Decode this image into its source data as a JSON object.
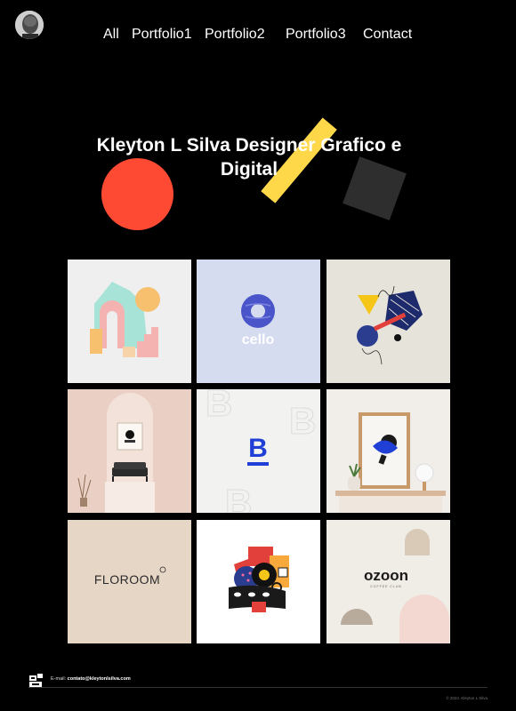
{
  "header": {
    "avatar_icon": "profile-photo",
    "nav": [
      {
        "label": "All"
      },
      {
        "label": "Portfolio1"
      },
      {
        "label": "Portfolio2"
      },
      {
        "label": "Portfolio3"
      },
      {
        "label": "Contact"
      }
    ]
  },
  "hero": {
    "title_line1": "Kleyton L Silva Designer Grafico e",
    "title_line2": "Digital",
    "colors": {
      "circle": "#ff4a33",
      "bar": "#ffd84a",
      "square": "#2e2e2e"
    }
  },
  "gallery": {
    "tiles": [
      {
        "icon": "geometric-arches-illustration",
        "bg": "#efefef"
      },
      {
        "icon": "cello-logo",
        "bg": "#d6dcf0",
        "text": "cello"
      },
      {
        "icon": "abstract-shapes-collage",
        "bg": "#e6e3da"
      },
      {
        "icon": "interior-mockup",
        "bg": "#efd9cf"
      },
      {
        "icon": "letter-b-brand-mark",
        "bg": "#f2f2f0"
      },
      {
        "icon": "framed-poster-mockup",
        "bg": "#f1eeea"
      },
      {
        "icon": "floroom-logo",
        "bg": "#e6d6c6",
        "text": "FLOROOM"
      },
      {
        "icon": "colorful-abstract-face",
        "bg": "#ffffff"
      },
      {
        "icon": "ozoon-logo",
        "bg": "#f0ece6",
        "text": "ozoon",
        "subtext": "COFFEE CLUB"
      }
    ]
  },
  "footer": {
    "logo_icon": "ks-monogram-icon",
    "email_label": "E-mail:",
    "email": "contato@kleytonlsilva.com",
    "copyright": "© 2024. Kleyton L Silva"
  }
}
